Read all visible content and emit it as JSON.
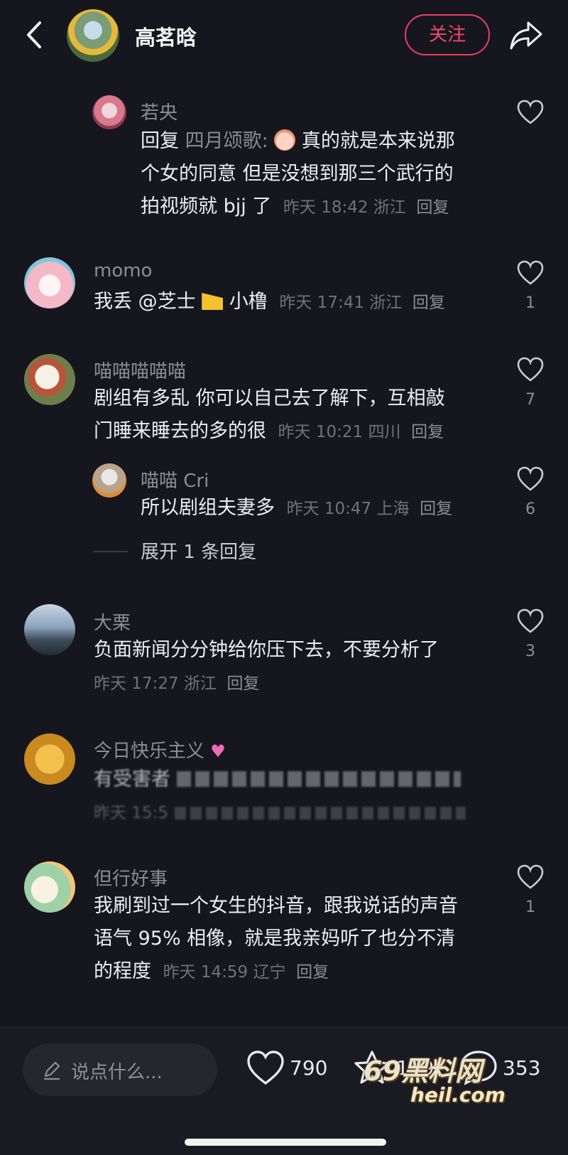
{
  "header": {
    "author_name": "高茗晗",
    "follow_label": "关注"
  },
  "comments": [
    {
      "username": "若央",
      "text_line1_prefix": "回复",
      "text_line1_mention": "四月颂歌:",
      "text_line1_rest": "真的就是本来说那",
      "text_line2": "个女的同意 但是没想到那三个武行的",
      "text_line3": "拍视频就 bjj 了",
      "meta": "昨天 18:42 浙江",
      "reply": "回复",
      "likes": ""
    },
    {
      "username": "momo",
      "text_before": "我丢 @芝士",
      "text_after": "小橹",
      "meta": "昨天 17:41 浙江",
      "reply": "回复",
      "likes": "1"
    },
    {
      "username": "喵喵喵喵喵",
      "text_line1": "剧组有多乱 你可以自己去了解下，互相敲",
      "text_line2": "门睡来睡去的多的很",
      "meta": "昨天 10:21 四川",
      "reply": "回复",
      "likes": "7"
    },
    {
      "username": "喵喵 Cri",
      "text_line1": "所以剧组夫妻多",
      "meta": "昨天 10:47 上海",
      "reply": "回复",
      "likes": "6"
    },
    {
      "username": "大栗",
      "text_line1": "负面新闻分分钟给你压下去，不要分析了",
      "meta": "昨天 17:27 浙江",
      "reply": "回复",
      "likes": "3"
    },
    {
      "username": "今日快乐主义",
      "text_line1": "有受害者",
      "meta": "昨天 15:5"
    },
    {
      "username": "但行好事",
      "text_line1": "我刷到过一个女生的抖音，跟我说话的声音",
      "text_line2": "语气 95% 相像，就是我亲妈听了也分不清",
      "text_line3": "的程度",
      "meta": "昨天 14:59 辽宁",
      "reply": "回复",
      "likes": "1"
    }
  ],
  "expand_replies": "展开 1 条回复",
  "bottom": {
    "input_placeholder": "说点什么...",
    "likes_count": "790",
    "favorites_count": "159",
    "comments_count": "353"
  },
  "watermark": {
    "line1": "69黑料网",
    "line2": "heil.com"
  },
  "colors": {
    "background": "#16161e",
    "accent": "#e8415f"
  }
}
